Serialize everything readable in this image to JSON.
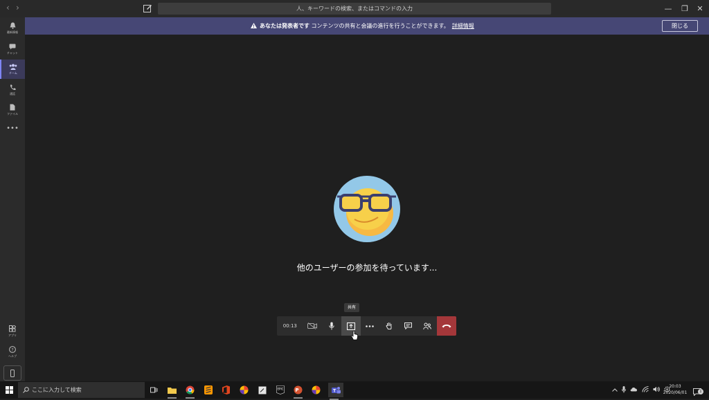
{
  "titlebar": {
    "back_glyph": "‹",
    "forward_glyph": "›",
    "search_placeholder": "人、キーワードの検索、またはコマンドの入力",
    "minimize_glyph": "—",
    "restore_glyph": "❐",
    "close_glyph": "✕"
  },
  "banner": {
    "bold_text": "あなたは発表者です",
    "text": "コンテンツの共有と会議の進行を行うことができます。",
    "link": "詳細情報",
    "close_label": "閉じる",
    "accent_color": "#464775"
  },
  "rail": {
    "items": [
      {
        "icon": "bell-icon",
        "label": "最新情報"
      },
      {
        "icon": "chat-icon",
        "label": "チャット"
      },
      {
        "icon": "teams-icon",
        "label": "チーム"
      },
      {
        "icon": "phone-icon",
        "label": "通話"
      },
      {
        "icon": "file-icon",
        "label": "ファイル"
      }
    ],
    "more_glyph": "•••",
    "apps_label": "アプリ",
    "help_label": "ヘルプ"
  },
  "meeting": {
    "waiting_text": "他のユーザーの参加を待っています...",
    "tooltip": "共有",
    "timer": "00:13",
    "hangup_color": "#a4373a"
  },
  "taskbar": {
    "search_placeholder": "ここに入力して検索",
    "clock_time": "20:03",
    "clock_date": "2020/06/01",
    "notification_count": "1"
  }
}
